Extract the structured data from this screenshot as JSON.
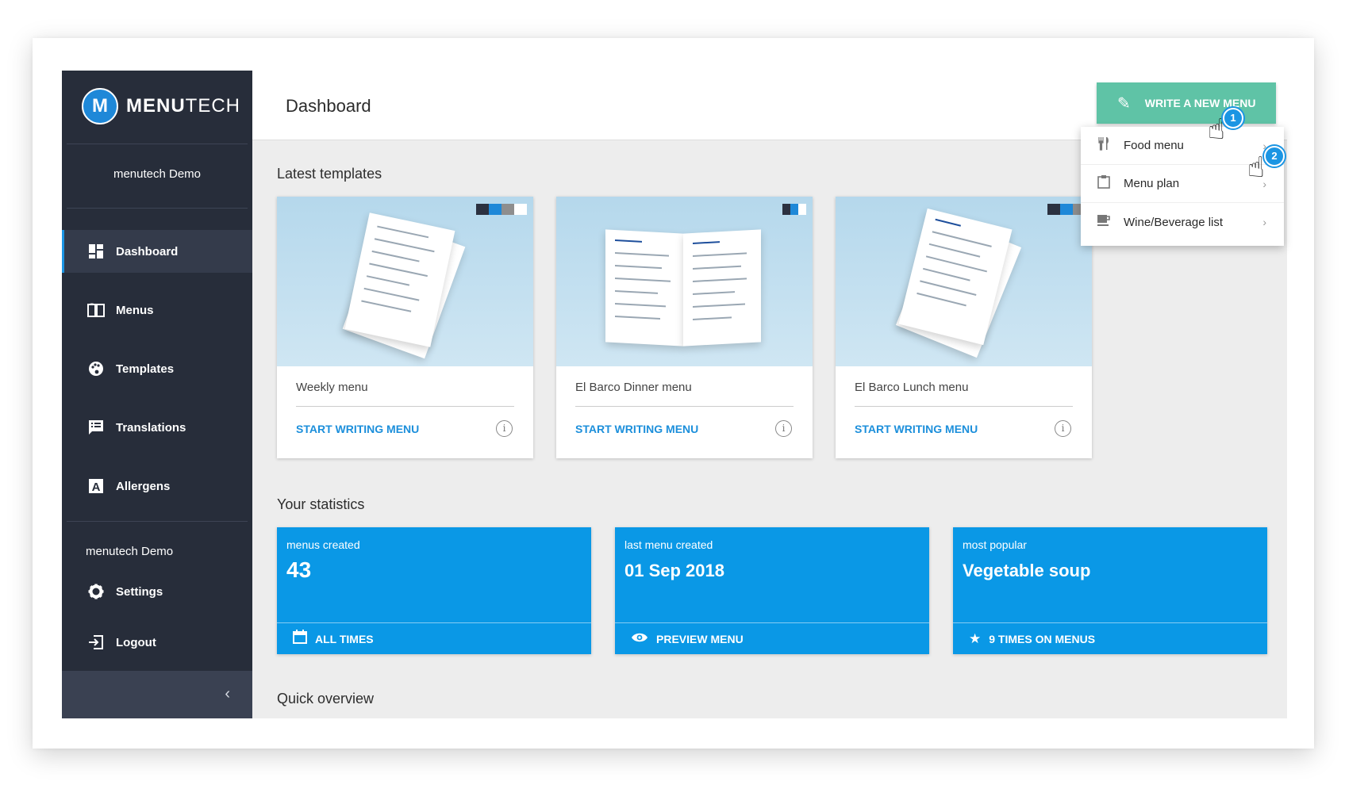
{
  "app": {
    "brand_bold": "MENU",
    "brand_light": "TECH",
    "logo_letter": "M"
  },
  "sidebar": {
    "account_name_top": "menutech Demo",
    "items": [
      {
        "label": "Dashboard",
        "icon": "dashboard-icon",
        "active": true
      },
      {
        "label": "Menus",
        "icon": "book-icon"
      },
      {
        "label": "Templates",
        "icon": "palette-icon"
      },
      {
        "label": "Translations",
        "icon": "chat-icon"
      },
      {
        "label": "Allergens",
        "icon": "letter-a-icon"
      }
    ],
    "account_name_bottom": "menutech Demo",
    "settings_label": "Settings",
    "logout_label": "Logout",
    "collapse_symbol": "‹"
  },
  "header": {
    "title": "Dashboard",
    "write_button_label": "WRITE A NEW MENU"
  },
  "dropdown": {
    "items": [
      {
        "label": "Food menu",
        "icon": "cutlery-icon"
      },
      {
        "label": "Menu plan",
        "icon": "clipboard-icon"
      },
      {
        "label": "Wine/Beverage list",
        "icon": "cup-icon"
      }
    ]
  },
  "steps": [
    "1",
    "2"
  ],
  "templates": {
    "section_title": "Latest templates",
    "cards": [
      {
        "name": "Weekly menu",
        "action": "START WRITING MENU",
        "swatches": [
          "#2b3140",
          "#1e88d8",
          "#8e8e8e",
          "#ffffff"
        ]
      },
      {
        "name": "El Barco Dinner menu",
        "action": "START WRITING MENU",
        "swatches": [
          "#2b3140",
          "#1e88d8",
          "#ffffff"
        ]
      },
      {
        "name": "El Barco Lunch menu",
        "action": "START WRITING MENU",
        "swatches": [
          "#2b3140",
          "#1e88d8",
          "#8e8e8e"
        ]
      }
    ]
  },
  "statistics": {
    "section_title": "Your statistics",
    "cards": [
      {
        "label": "menus created",
        "value": "43",
        "footer": "ALL TIMES"
      },
      {
        "label": "last menu created",
        "value": "01 Sep 2018",
        "footer": "PREVIEW MENU"
      },
      {
        "label": "most popular",
        "value": "Vegetable soup",
        "footer": "9 TIMES ON MENUS"
      }
    ]
  },
  "overview": {
    "section_title": "Quick overview"
  },
  "colors": {
    "sidebar": "#272d3a",
    "accent_green": "#5fc3a6",
    "accent_blue": "#0a98e6",
    "link_blue": "#1c8fdb"
  }
}
